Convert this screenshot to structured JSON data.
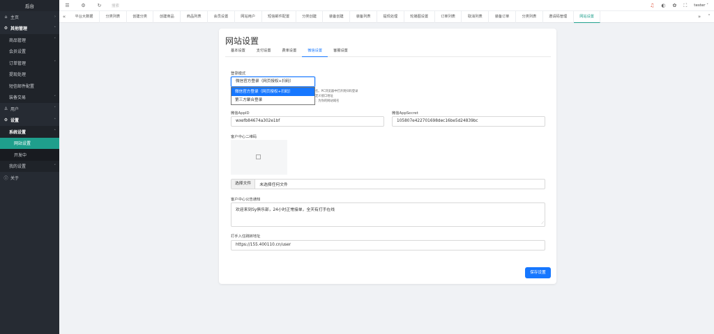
{
  "sidebar": {
    "title": "后台",
    "items": [
      {
        "label": "主页",
        "icon": "home-icon"
      },
      {
        "label": "其他管理",
        "icon": "gear-icon"
      },
      {
        "label": "商品管理"
      },
      {
        "label": "会员设置"
      },
      {
        "label": "订单管理"
      },
      {
        "label": "提现处理"
      },
      {
        "label": "短信邮件配置"
      },
      {
        "label": "装备交易"
      },
      {
        "label": "用户",
        "icon": "user-icon"
      },
      {
        "label": "设置",
        "icon": "gear-icon"
      },
      {
        "label": "系统设置"
      },
      {
        "label": "网站设置"
      },
      {
        "label": "开发中"
      },
      {
        "label": "我的设置"
      },
      {
        "label": "关于",
        "icon": "info-icon"
      }
    ]
  },
  "topbar": {
    "search_placeholder": "搜索",
    "user": "tester"
  },
  "tabs": [
    "平台大数据",
    "分类列表",
    "创建分类",
    "创建商品",
    "商品列表",
    "会员设置",
    "网站用户",
    "短信邮件配置",
    "分类创建",
    "装备创建",
    "装备列表",
    "提现处理",
    "轮播图设置",
    "订单列表",
    "取消列表",
    "装备订单",
    "分类列表",
    "邀请码管理",
    "网站设置"
  ],
  "active_tab": "网站设置",
  "page": {
    "title": "网站设置",
    "sub_tabs": [
      "基本设置",
      "支付设置",
      "费率设置",
      "微信设置",
      "客服设置"
    ],
    "active_sub_tab": "微信设置",
    "login_mode_label": "登录模式",
    "login_mode_value": "微信官方登录（网页授权+扫码）",
    "login_mode_options": [
      "微信官方登录（网页授权+扫码）",
      "第三方聚合登录"
    ],
    "hint_lines": [
      "名。PC浏览器中打开则扫码登录",
      "定义接口地址",
      "：为你的网站域名"
    ],
    "appid_label": "微信AppID",
    "appid_value": "wxefb84674a302e1bf",
    "appsecret_label": "微信AppSecret",
    "appsecret_value": "105807e422701698dec16be5d24839bc",
    "qrcode_label": "客户中心二维码",
    "file_button": "选择文件",
    "file_status": "未选择任何文件",
    "notice_label": "客户中心公告通知",
    "notice_value": "欢迎来到Sy俱乐部，24小时正常接单，全天有打手在线",
    "redirect_label": "打手入住跳转地址",
    "redirect_value": "https://155.400110.cn/user",
    "save_button": "保存设置"
  },
  "colors": {
    "accent": "#1677ff",
    "sidebar_active": "#1f9f8c",
    "sidebar_bg": "#262b33"
  }
}
